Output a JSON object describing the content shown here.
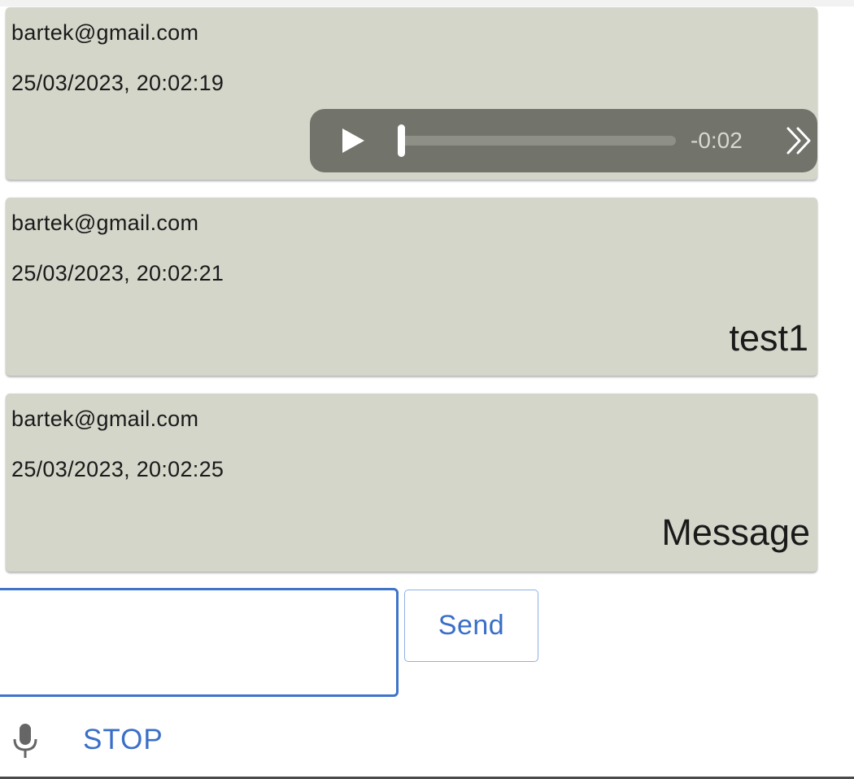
{
  "messages": [
    {
      "sender": "bartek@gmail.com",
      "timestamp": "25/03/2023, 20:02:19",
      "type": "audio",
      "audio": {
        "time_remaining": "-0:02",
        "progress": 0.0,
        "play_icon": "play-icon",
        "more_icon": "chevron-double-right-icon"
      }
    },
    {
      "sender": "bartek@gmail.com",
      "timestamp": "25/03/2023, 20:02:21",
      "type": "text",
      "text": "test1"
    },
    {
      "sender": "bartek@gmail.com",
      "timestamp": "25/03/2023, 20:02:25",
      "type": "text",
      "text": "Message"
    }
  ],
  "composer": {
    "input_value": "",
    "send_label": "Send",
    "mic_icon": "microphone-icon",
    "stop_label": "STOP"
  },
  "colors": {
    "card_background": "#d4d6ca",
    "audio_player_background": "#72736b",
    "accent_blue": "#3a6fc8",
    "input_border": "#3f74c9"
  }
}
